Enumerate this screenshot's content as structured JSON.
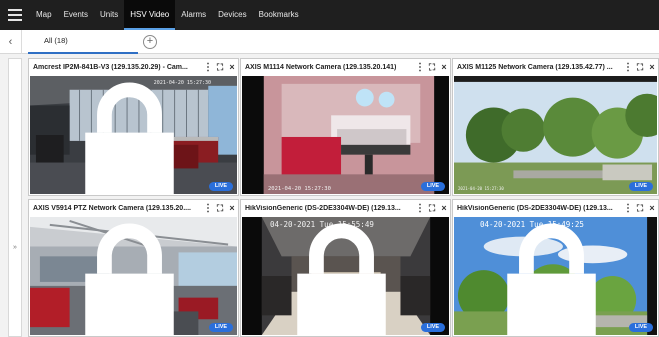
{
  "nav": {
    "items": [
      {
        "label": "Map",
        "active": false
      },
      {
        "label": "Events",
        "active": false
      },
      {
        "label": "Units",
        "active": false
      },
      {
        "label": "HSV Video",
        "active": true
      },
      {
        "label": "Alarms",
        "active": false
      },
      {
        "label": "Devices",
        "active": false
      },
      {
        "label": "Bookmarks",
        "active": false
      }
    ]
  },
  "tabs": {
    "active_label": "All (18)"
  },
  "live_label": "LIVE",
  "tiles": [
    {
      "title": "Amcrest IP2M-841B-V3 (129.135.20.29) - Cam...",
      "timestamp": "2021-04-20 15:27:30"
    },
    {
      "title": "AXIS M1114 Network Camera (129.135.20.141)",
      "timestamp": "2021-04-20 15:27:30"
    },
    {
      "title": "AXIS M1125 Network Camera (129.135.42.77) ...",
      "timestamp": "2021-04-20 15:27:30"
    },
    {
      "title": "AXIS V5914 PTZ Network Camera (129.135.20....",
      "timestamp": ""
    },
    {
      "title": "HikVisionGeneric (DS-2DE3304W-DE) (129.13...",
      "timestamp": "04-20-2021 Tue 15:55:49"
    },
    {
      "title": "HikVisionGeneric (DS-2DE3304W-DE) (129.13...",
      "timestamp": "04-20-2021 Tue 15:49:25"
    }
  ],
  "colors": {
    "nav_bg": "#1f1f1f",
    "accent": "#2f6fc4",
    "live_badge": "#2a6fdb"
  }
}
